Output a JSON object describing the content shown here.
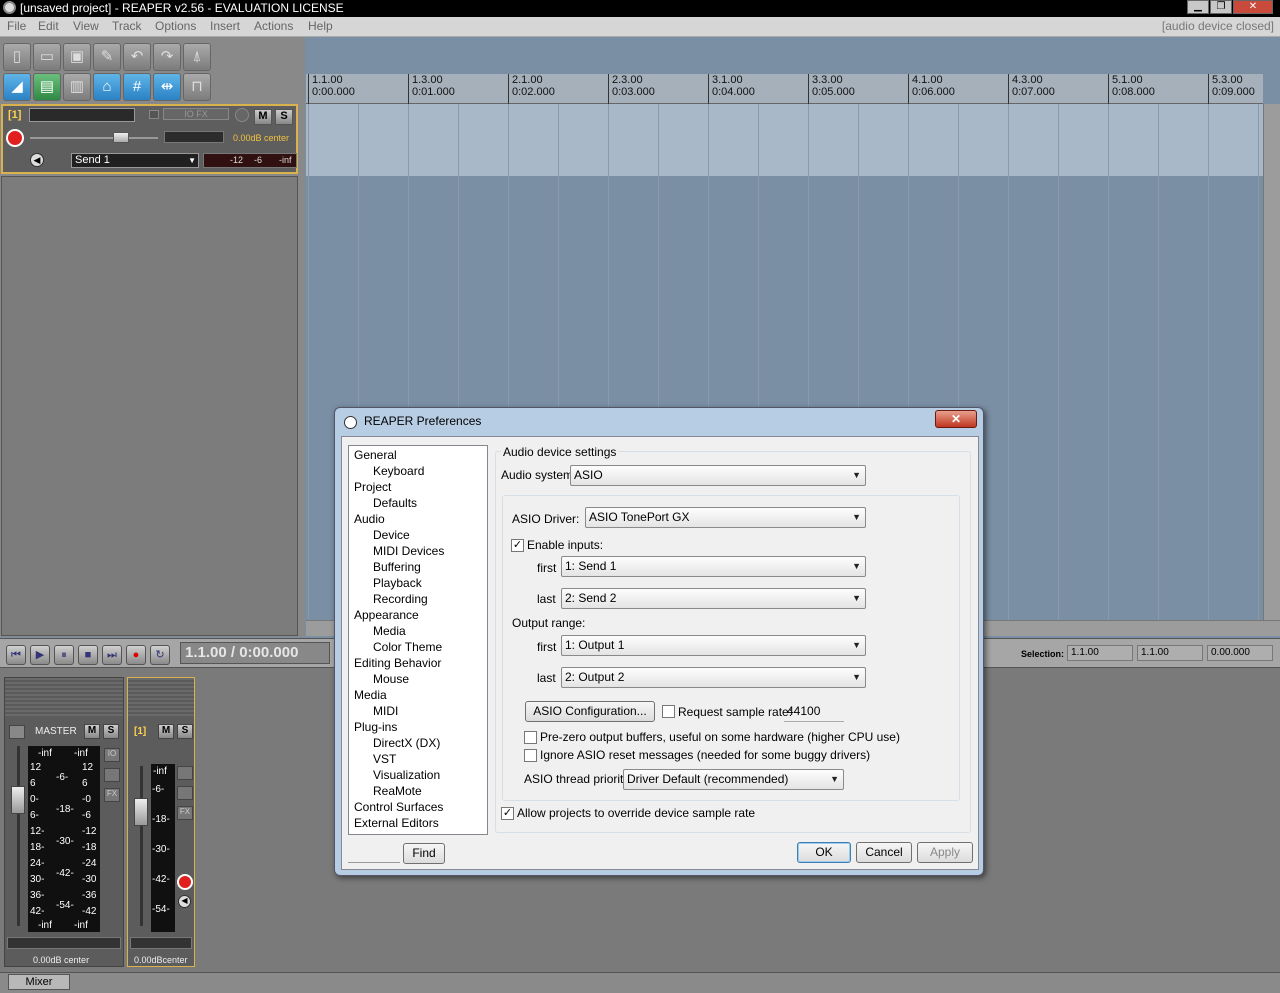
{
  "window": {
    "title": "[unsaved project] - REAPER v2.56 - EVALUATION LICENSE",
    "min": "▁",
    "max": "❐",
    "close": "✕"
  },
  "menu": {
    "items": [
      "File",
      "Edit",
      "View",
      "Track",
      "Options",
      "Insert",
      "Actions",
      "Help"
    ],
    "status": "[audio device closed]"
  },
  "ruler": {
    "ticks": [
      {
        "bar": "1.1.00",
        "time": "0:00.000"
      },
      {
        "bar": "1.3.00",
        "time": "0:01.000"
      },
      {
        "bar": "2.1.00",
        "time": "0:02.000"
      },
      {
        "bar": "2.3.00",
        "time": "0:03.000"
      },
      {
        "bar": "3.1.00",
        "time": "0:04.000"
      },
      {
        "bar": "3.3.00",
        "time": "0:05.000"
      },
      {
        "bar": "4.1.00",
        "time": "0:06.000"
      },
      {
        "bar": "4.3.00",
        "time": "0:07.000"
      },
      {
        "bar": "5.1.00",
        "time": "0:08.000"
      },
      {
        "bar": "5.3.00",
        "time": "0:09.000"
      }
    ]
  },
  "track": {
    "number": "[1]",
    "mute": "M",
    "solo": "S",
    "volume_text": "0.00dB center",
    "input": "Send 1",
    "meter_labels": [
      "-12",
      "-6",
      "-inf"
    ],
    "fx": "FX",
    "io": "IO"
  },
  "transport": {
    "time": "1.1.00 / 0:00.000",
    "selection_label": "Selection:",
    "sel_start": "1.1.00",
    "sel_end": "1.1.00",
    "sel_len": "0.00.000"
  },
  "mixer": {
    "master": {
      "name": "MASTER",
      "mute": "M",
      "solo": "S",
      "peak_l": "-inf",
      "peak_r": "-inf",
      "scale_left": [
        "12",
        "6",
        "0-",
        "6-",
        "12-",
        "18-",
        "24-",
        "30-",
        "36-",
        "42-"
      ],
      "scale_mid": [
        "-6-",
        "-18-",
        "-30-",
        "-42-",
        "-54-"
      ],
      "scale_right": [
        "12",
        "6",
        "-0",
        "-6",
        "-12",
        "-18",
        "-24",
        "-30",
        "-36",
        "-42"
      ],
      "bottom_l": "-inf",
      "bottom_r": "-inf",
      "vol": "0.00dB",
      "pan": "center"
    },
    "track1": {
      "name": "[1]",
      "mute": "M",
      "solo": "S",
      "peak": "-inf",
      "scale": [
        "-6-",
        "-18-",
        "-30-",
        "-42-",
        "-54-"
      ],
      "vol": "0.00dB",
      "pan": "center"
    },
    "tab": "Mixer"
  },
  "dialog": {
    "title": "REAPER Preferences",
    "close": "✕",
    "tree": [
      {
        "label": "General",
        "indent": 0
      },
      {
        "label": "Keyboard",
        "indent": 1
      },
      {
        "label": "Project",
        "indent": 0
      },
      {
        "label": "Defaults",
        "indent": 1
      },
      {
        "label": "Audio",
        "indent": 0
      },
      {
        "label": "Device",
        "indent": 1
      },
      {
        "label": "MIDI Devices",
        "indent": 1
      },
      {
        "label": "Buffering",
        "indent": 1
      },
      {
        "label": "Playback",
        "indent": 1
      },
      {
        "label": "Recording",
        "indent": 1
      },
      {
        "label": "Appearance",
        "indent": 0
      },
      {
        "label": "Media",
        "indent": 1
      },
      {
        "label": "Color Theme",
        "indent": 1
      },
      {
        "label": "Editing Behavior",
        "indent": 0
      },
      {
        "label": "Mouse",
        "indent": 1
      },
      {
        "label": "Media",
        "indent": 0
      },
      {
        "label": "MIDI",
        "indent": 1
      },
      {
        "label": "Plug-ins",
        "indent": 0
      },
      {
        "label": "DirectX (DX)",
        "indent": 1
      },
      {
        "label": "VST",
        "indent": 1
      },
      {
        "label": "Visualization",
        "indent": 1
      },
      {
        "label": "ReaMote",
        "indent": 1
      },
      {
        "label": "Control Surfaces",
        "indent": 0
      },
      {
        "label": "External Editors",
        "indent": 0
      }
    ],
    "find_placeholder": "",
    "find": "Find",
    "section": "Audio device settings",
    "audio_system_label": "Audio system:",
    "audio_system": "ASIO",
    "asio_driver_label": "ASIO Driver:",
    "asio_driver": "ASIO TonePort GX",
    "enable_inputs": "Enable inputs:",
    "first": "first",
    "last": "last",
    "input_first": "1: Send 1",
    "input_last": "2: Send 2",
    "output_range": "Output range:",
    "output_first": "1: Output 1",
    "output_last": "2: Output 2",
    "asio_config": "ASIO Configuration...",
    "request_rate": "Request sample rate:",
    "sample_rate": "44100",
    "prezero": "Pre-zero output buffers, useful on some hardware (higher CPU use)",
    "ignore_reset": "Ignore ASIO reset messages (needed for some buggy drivers)",
    "thread_priority_label": "ASIO thread priority:",
    "thread_priority": "Driver Default (recommended)",
    "allow_override": "Allow projects to override device sample rate",
    "ok": "OK",
    "cancel": "Cancel",
    "apply": "Apply",
    "check": "✓"
  }
}
